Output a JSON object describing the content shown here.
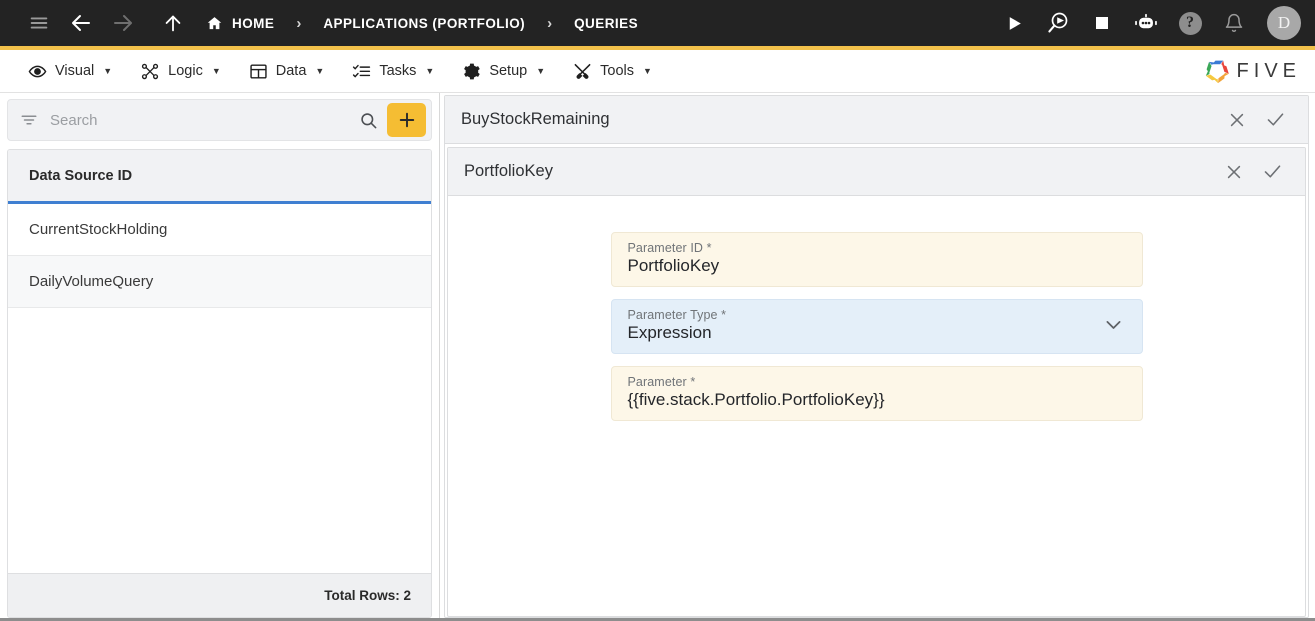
{
  "topbar": {
    "icons": {
      "menu": "hamburger-menu-icon",
      "back": "back-arrow-icon",
      "forward": "forward-arrow-icon",
      "up": "up-arrow-icon",
      "run": "play-icon",
      "debug": "debug-run-icon",
      "stop": "stop-icon",
      "assistant": "robot-assistant-icon",
      "help": "help-icon",
      "notifications": "bell-icon"
    },
    "breadcrumbs": [
      {
        "label": "HOME",
        "icon": "home-icon"
      },
      {
        "label": "APPLICATIONS (PORTFOLIO)",
        "icon": ""
      },
      {
        "label": "QUERIES",
        "icon": ""
      }
    ],
    "separator": "›",
    "avatar_initial": "D",
    "help_glyph": "?"
  },
  "menubar": {
    "items": [
      {
        "label": "Visual",
        "icon": "eye-icon",
        "caret": "▼"
      },
      {
        "label": "Logic",
        "icon": "logic-nodes-icon",
        "caret": "▼"
      },
      {
        "label": "Data",
        "icon": "data-table-icon",
        "caret": "▼"
      },
      {
        "label": "Tasks",
        "icon": "tasks-checklist-icon",
        "caret": "▼"
      },
      {
        "label": "Setup",
        "icon": "gear-icon",
        "caret": "▼"
      },
      {
        "label": "Tools",
        "icon": "tools-wrench-icon",
        "caret": "▼"
      }
    ],
    "brand": {
      "name": "FIVE",
      "logo": "five-pinwheel-logo",
      "colors": [
        "#3a7bd5",
        "#e8453c",
        "#f2a43a",
        "#f5c93f",
        "#3aa757"
      ]
    }
  },
  "sidebar": {
    "search": {
      "placeholder": "Search",
      "value": "",
      "filter_icon": "filter-icon",
      "search_icon": "search-icon"
    },
    "add_button": {
      "glyph": "+",
      "color": "#f5bd33"
    },
    "grid": {
      "column_header": "Data Source ID",
      "rows": [
        {
          "name": "CurrentStockHolding"
        },
        {
          "name": "DailyVolumeQuery"
        }
      ],
      "footer": "Total Rows: 2",
      "accent_color": "#3f7fd1"
    }
  },
  "main": {
    "outer_panel": {
      "title": "BuyStockRemaining",
      "close_icon": "close-x-icon",
      "confirm_icon": "check-icon"
    },
    "inner_panel": {
      "title": "PortfolioKey",
      "close_icon": "close-x-icon",
      "confirm_icon": "check-icon"
    },
    "form": {
      "fields": [
        {
          "label": "Parameter ID *",
          "value": "PortfolioKey",
          "style": "cream",
          "control": "text"
        },
        {
          "label": "Parameter Type *",
          "value": "Expression",
          "style": "blue",
          "control": "select",
          "chevron": "chevron-down-icon"
        },
        {
          "label": "Parameter *",
          "value": "{{five.stack.Portfolio.PortfolioKey}}",
          "style": "cream",
          "control": "text"
        }
      ]
    }
  }
}
